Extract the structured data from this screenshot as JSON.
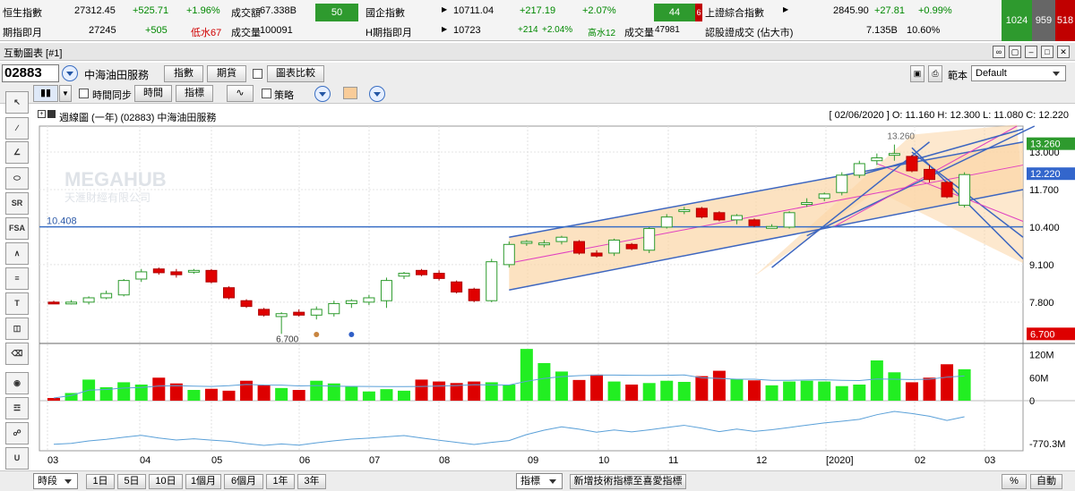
{
  "ticker": {
    "row1": {
      "hsi_label": "恒生指數",
      "hsi_value": "27312.45",
      "hsi_change": "+525.71",
      "hsi_pct": "+1.96%",
      "turnover_label": "成交額",
      "turnover_value": "67.338B",
      "hsi_box": "50",
      "hscei_label": "國企指數",
      "hscei_value": "10711.04",
      "hscei_change": "+217.19",
      "hscei_pct": "+2.07%",
      "hscei_box": "44",
      "hscei_box2": "6",
      "sse_label": "上證綜合指數",
      "sse_value": "2845.90",
      "sse_change": "+27.81",
      "sse_pct": "+0.99%"
    },
    "row2": {
      "hsif_label": "期指即月",
      "hsif_value": "27245",
      "hsif_change": "+505",
      "hsif_disc": "低水67",
      "hsif_vol_label": "成交量",
      "hsif_vol": "100091",
      "hhif_label": "H期指即月",
      "hhif_value": "10723",
      "hhif_change": "+214",
      "hhif_pct": "+2.04%",
      "hhif_prem": "高水12",
      "hhif_vol_label": "成交量",
      "hhif_vol": "47981",
      "warrant_label": "認股證成交 (佔大市)",
      "warrant_value": "7.135B",
      "warrant_pct": "10.60%"
    },
    "breadth": {
      "up": "1024",
      "flat": "959",
      "down": "518"
    }
  },
  "window": {
    "title": "互動圖表 [#1]"
  },
  "toolbar": {
    "stock_code": "02883",
    "stock_name": "中海油田服務",
    "btn_index": "指數",
    "btn_futures": "期貨",
    "btn_compare": "圖表比較",
    "sync_label": "時間同步",
    "btn_time": "時間",
    "btn_indicator": "指標",
    "strategy_label": "策略",
    "template_label": "範本",
    "template_value": "Default"
  },
  "chart_info": {
    "left": "週線圖 (一年) (02883) 中海油田服務",
    "right": "[ 02/06/2020 ]  O: 11.160  H: 12.300  L: 11.080  C: 12.220"
  },
  "watermark": {
    "title": "MEGAHUB",
    "subtitle": "天滙財經有限公司"
  },
  "chart_data": {
    "type": "candlestick",
    "months": [
      "03",
      "04",
      "05",
      "06",
      "07",
      "08",
      "09",
      "10",
      "11",
      "12",
      "[2020]",
      "02",
      "03"
    ],
    "y_ticks": [
      "13.000",
      "11.700",
      "10.400",
      "9.100",
      "7.800"
    ],
    "price_labels": {
      "current": "12.220",
      "high": "13.260",
      "low": "6.700",
      "prev_high": "13.260"
    },
    "annotations": {
      "high": "13.260",
      "low": "6.700",
      "hline": "10.408"
    },
    "hline": 10.408,
    "ylim": [
      6.4,
      13.9
    ],
    "candles": [
      {
        "o": 7.8,
        "h": 7.85,
        "l": 7.75,
        "c": 7.78
      },
      {
        "o": 7.8,
        "h": 7.87,
        "l": 7.72,
        "c": 7.8
      },
      {
        "o": 7.8,
        "h": 8.0,
        "l": 7.72,
        "c": 7.95
      },
      {
        "o": 7.95,
        "h": 8.2,
        "l": 7.9,
        "c": 8.1
      },
      {
        "o": 8.05,
        "h": 8.6,
        "l": 8.0,
        "c": 8.55
      },
      {
        "o": 8.6,
        "h": 8.95,
        "l": 8.5,
        "c": 8.85
      },
      {
        "o": 8.95,
        "h": 9.0,
        "l": 8.75,
        "c": 8.82
      },
      {
        "o": 8.85,
        "h": 8.95,
        "l": 8.65,
        "c": 8.75
      },
      {
        "o": 8.85,
        "h": 8.95,
        "l": 8.78,
        "c": 8.9
      },
      {
        "o": 8.9,
        "h": 8.95,
        "l": 8.45,
        "c": 8.5
      },
      {
        "o": 8.3,
        "h": 8.35,
        "l": 7.9,
        "c": 7.95
      },
      {
        "o": 7.85,
        "h": 7.9,
        "l": 7.6,
        "c": 7.65
      },
      {
        "o": 7.55,
        "h": 7.6,
        "l": 7.3,
        "c": 7.35
      },
      {
        "o": 7.3,
        "h": 7.45,
        "l": 6.7,
        "c": 7.4
      },
      {
        "o": 7.45,
        "h": 7.55,
        "l": 7.3,
        "c": 7.35
      },
      {
        "o": 7.35,
        "h": 7.65,
        "l": 7.2,
        "c": 7.55
      },
      {
        "o": 7.4,
        "h": 7.85,
        "l": 7.3,
        "c": 7.75
      },
      {
        "o": 7.75,
        "h": 7.9,
        "l": 7.6,
        "c": 7.85
      },
      {
        "o": 7.8,
        "h": 8.05,
        "l": 7.7,
        "c": 7.95
      },
      {
        "o": 7.85,
        "h": 8.65,
        "l": 7.6,
        "c": 8.55
      },
      {
        "o": 8.7,
        "h": 8.85,
        "l": 8.6,
        "c": 8.8
      },
      {
        "o": 8.9,
        "h": 8.95,
        "l": 8.7,
        "c": 8.75
      },
      {
        "o": 8.8,
        "h": 8.9,
        "l": 8.55,
        "c": 8.62
      },
      {
        "o": 8.5,
        "h": 8.55,
        "l": 8.1,
        "c": 8.15
      },
      {
        "o": 8.25,
        "h": 8.3,
        "l": 7.8,
        "c": 7.85
      },
      {
        "o": 7.85,
        "h": 9.3,
        "l": 7.8,
        "c": 9.2
      },
      {
        "o": 9.1,
        "h": 9.9,
        "l": 9.0,
        "c": 9.8
      },
      {
        "o": 9.85,
        "h": 9.95,
        "l": 9.75,
        "c": 9.9
      },
      {
        "o": 9.8,
        "h": 9.95,
        "l": 9.7,
        "c": 9.85
      },
      {
        "o": 9.9,
        "h": 10.1,
        "l": 9.8,
        "c": 10.05
      },
      {
        "o": 9.9,
        "h": 9.95,
        "l": 9.45,
        "c": 9.5
      },
      {
        "o": 9.5,
        "h": 9.6,
        "l": 9.35,
        "c": 9.4
      },
      {
        "o": 9.5,
        "h": 10.0,
        "l": 9.4,
        "c": 9.95
      },
      {
        "o": 9.8,
        "h": 9.85,
        "l": 9.6,
        "c": 9.65
      },
      {
        "o": 9.6,
        "h": 10.4,
        "l": 9.5,
        "c": 10.35
      },
      {
        "o": 10.4,
        "h": 10.85,
        "l": 10.35,
        "c": 10.75
      },
      {
        "o": 10.95,
        "h": 11.1,
        "l": 10.85,
        "c": 11.0
      },
      {
        "o": 11.05,
        "h": 11.1,
        "l": 10.7,
        "c": 10.75
      },
      {
        "o": 10.9,
        "h": 10.95,
        "l": 10.6,
        "c": 10.65
      },
      {
        "o": 10.65,
        "h": 10.85,
        "l": 10.5,
        "c": 10.8
      },
      {
        "o": 10.65,
        "h": 10.7,
        "l": 10.4,
        "c": 10.45
      },
      {
        "o": 10.4,
        "h": 10.5,
        "l": 10.35,
        "c": 10.42
      },
      {
        "o": 10.4,
        "h": 10.95,
        "l": 10.35,
        "c": 10.9
      },
      {
        "o": 11.2,
        "h": 11.4,
        "l": 11.1,
        "c": 11.25
      },
      {
        "o": 11.4,
        "h": 11.6,
        "l": 11.3,
        "c": 11.55
      },
      {
        "o": 11.6,
        "h": 12.3,
        "l": 11.5,
        "c": 12.2
      },
      {
        "o": 12.2,
        "h": 12.7,
        "l": 12.1,
        "c": 12.6
      },
      {
        "o": 12.7,
        "h": 12.95,
        "l": 12.55,
        "c": 12.8
      },
      {
        "o": 12.9,
        "h": 13.26,
        "l": 12.7,
        "c": 12.95
      },
      {
        "o": 12.85,
        "h": 12.9,
        "l": 12.3,
        "c": 12.35
      },
      {
        "o": 12.4,
        "h": 12.55,
        "l": 11.95,
        "c": 12.05
      },
      {
        "o": 11.95,
        "h": 12.0,
        "l": 11.4,
        "c": 11.45
      },
      {
        "o": 11.16,
        "h": 12.3,
        "l": 11.08,
        "c": 12.22
      }
    ],
    "volume_ticks": [
      "120M",
      "60M",
      "0"
    ],
    "volume": [
      7,
      20,
      55,
      35,
      48,
      42,
      60,
      45,
      28,
      31,
      26,
      52,
      40,
      33,
      28,
      52,
      45,
      38,
      24,
      30,
      26,
      55,
      50,
      46,
      50,
      48,
      42,
      135,
      98,
      76,
      54,
      68,
      50,
      42,
      46,
      52,
      49,
      64,
      78,
      57,
      53,
      40,
      50,
      52,
      50,
      38,
      42,
      105,
      74,
      48,
      60,
      95,
      82,
      42,
      32,
      54
    ],
    "obv_tick": "-770.3M",
    "series": [
      {
        "name": "上升通道",
        "type": "channel"
      },
      {
        "name": "下降通道",
        "type": "channel"
      }
    ]
  },
  "bottom": {
    "period_label": "時段",
    "periods": [
      "1日",
      "5日",
      "10日",
      "1個月",
      "6個月",
      "1年",
      "3年"
    ],
    "indicator_label": "指標",
    "add_btn": "新增技術指標至喜愛指標",
    "pct_btn": "%",
    "auto_btn": "自動"
  }
}
